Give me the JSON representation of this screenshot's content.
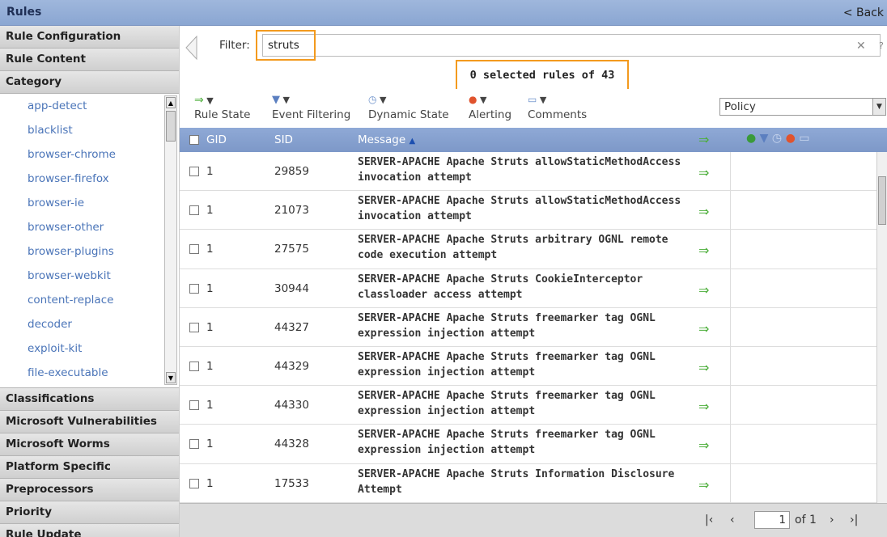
{
  "window": {
    "title": "Rules",
    "back_label": "< Back"
  },
  "sidebar": {
    "sections_top": [
      "Rule Configuration",
      "Rule Content",
      "Category"
    ],
    "category_items": [
      "app-detect",
      "blacklist",
      "browser-chrome",
      "browser-firefox",
      "browser-ie",
      "browser-other",
      "browser-plugins",
      "browser-webkit",
      "content-replace",
      "decoder",
      "exploit-kit",
      "file-executable"
    ],
    "sections_bottom": [
      "Classifications",
      "Microsoft Vulnerabilities",
      "Microsoft Worms",
      "Platform Specific",
      "Preprocessors",
      "Priority",
      "Rule Update"
    ]
  },
  "filter": {
    "label": "Filter:",
    "value": "struts",
    "clear_icon": "close-icon",
    "help_label": "?"
  },
  "selection": {
    "text": "0 selected rules of 43"
  },
  "toolbar": {
    "rule_state": "Rule State",
    "event_filtering": "Event Filtering",
    "dynamic_state": "Dynamic State",
    "alerting": "Alerting",
    "comments": "Comments",
    "policy_select": "Policy"
  },
  "table": {
    "headers": {
      "gid": "GID",
      "sid": "SID",
      "message": "Message",
      "sort_indicator": "▲"
    },
    "rows": [
      {
        "gid": "1",
        "sid": "29859",
        "message": "SERVER-APACHE Apache Struts allowStaticMethodAccess invocation attempt"
      },
      {
        "gid": "1",
        "sid": "21073",
        "message": "SERVER-APACHE Apache Struts allowStaticMethodAccess invocation attempt"
      },
      {
        "gid": "1",
        "sid": "27575",
        "message": "SERVER-APACHE Apache Struts arbitrary OGNL remote code execution attempt"
      },
      {
        "gid": "1",
        "sid": "30944",
        "message": "SERVER-APACHE Apache Struts CookieInterceptor classloader access attempt"
      },
      {
        "gid": "1",
        "sid": "44327",
        "message": "SERVER-APACHE Apache Struts freemarker tag OGNL expression injection attempt"
      },
      {
        "gid": "1",
        "sid": "44329",
        "message": "SERVER-APACHE Apache Struts freemarker tag OGNL expression injection attempt"
      },
      {
        "gid": "1",
        "sid": "44330",
        "message": "SERVER-APACHE Apache Struts freemarker tag OGNL expression injection attempt"
      },
      {
        "gid": "1",
        "sid": "44328",
        "message": "SERVER-APACHE Apache Struts freemarker tag OGNL expression injection attempt"
      },
      {
        "gid": "1",
        "sid": "17533",
        "message": "SERVER-APACHE Apache Struts Information Disclosure Attempt"
      }
    ]
  },
  "pagination": {
    "page": "1",
    "of_label": "of 1"
  },
  "colors": {
    "header_blue": "#8fa9d6",
    "link_blue": "#4a74b8",
    "highlight_orange": "#f39a1e",
    "state_green": "#4cae3a"
  }
}
